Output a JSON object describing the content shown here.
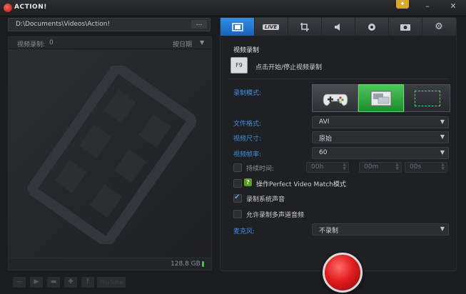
{
  "app": {
    "title": "ACTION!"
  },
  "left": {
    "path": "D:\\Documents\\Videos\\Action!",
    "browse_label": "...",
    "list_count_label": "视频录制:",
    "list_count": "0",
    "sort_label": "按日期",
    "disk_free": "128.8 GB",
    "youtube_label": "YouTube"
  },
  "tabs": [
    {
      "name": "video"
    },
    {
      "name": "live",
      "label": "LIVE"
    },
    {
      "name": "screenshot"
    },
    {
      "name": "audio"
    },
    {
      "name": "webcam"
    },
    {
      "name": "camera"
    },
    {
      "name": "settings"
    }
  ],
  "video": {
    "section_title": "视频录制",
    "hotkey": "F9",
    "hotkey_desc": "点击开始/停止视频录制",
    "mode_label": "录制模式:",
    "format_label": "文件格式:",
    "format_value": "AVI",
    "size_label": "视频尺寸:",
    "size_value": "原始",
    "fps_label": "视频帧率:",
    "fps_value": "60",
    "duration_label": "持续时间:",
    "duration": {
      "h": "00h",
      "m": "00m",
      "s": "00s"
    },
    "pvm_label": "操作Perfect Video Match模式",
    "system_sound_label": "录制系统声音",
    "multi_audio_label": "允许录制多声道音频",
    "mic_label": "麦克风:",
    "mic_value": "不录制"
  },
  "colors": {
    "accent_blue": "#1a62b8",
    "label_blue": "#3f8fe0",
    "record_red": "#e11d1d",
    "screen_mode_green": "#2fa83f"
  }
}
